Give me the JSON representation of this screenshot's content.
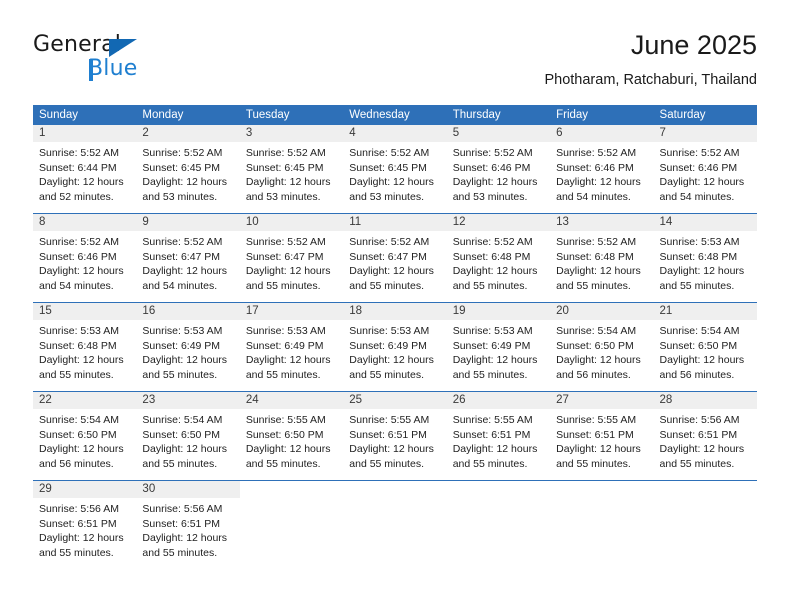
{
  "brand": {
    "name_part1": "General",
    "name_part2": "Blue",
    "flag_icon": "blue-flag-icon"
  },
  "header": {
    "title": "June 2025",
    "location": "Photharam, Ratchaburi, Thailand"
  },
  "colors": {
    "header_blue": "#2e70b8",
    "datebar_gray": "#efefef",
    "brand_blue": "#1f7fd0",
    "text": "#222222"
  },
  "weekdays": [
    "Sunday",
    "Monday",
    "Tuesday",
    "Wednesday",
    "Thursday",
    "Friday",
    "Saturday"
  ],
  "weeks": [
    [
      {
        "date": "1",
        "sunrise": "Sunrise: 5:52 AM",
        "sunset": "Sunset: 6:44 PM",
        "daylight": "Daylight: 12 hours and 52 minutes."
      },
      {
        "date": "2",
        "sunrise": "Sunrise: 5:52 AM",
        "sunset": "Sunset: 6:45 PM",
        "daylight": "Daylight: 12 hours and 53 minutes."
      },
      {
        "date": "3",
        "sunrise": "Sunrise: 5:52 AM",
        "sunset": "Sunset: 6:45 PM",
        "daylight": "Daylight: 12 hours and 53 minutes."
      },
      {
        "date": "4",
        "sunrise": "Sunrise: 5:52 AM",
        "sunset": "Sunset: 6:45 PM",
        "daylight": "Daylight: 12 hours and 53 minutes."
      },
      {
        "date": "5",
        "sunrise": "Sunrise: 5:52 AM",
        "sunset": "Sunset: 6:46 PM",
        "daylight": "Daylight: 12 hours and 53 minutes."
      },
      {
        "date": "6",
        "sunrise": "Sunrise: 5:52 AM",
        "sunset": "Sunset: 6:46 PM",
        "daylight": "Daylight: 12 hours and 54 minutes."
      },
      {
        "date": "7",
        "sunrise": "Sunrise: 5:52 AM",
        "sunset": "Sunset: 6:46 PM",
        "daylight": "Daylight: 12 hours and 54 minutes."
      }
    ],
    [
      {
        "date": "8",
        "sunrise": "Sunrise: 5:52 AM",
        "sunset": "Sunset: 6:46 PM",
        "daylight": "Daylight: 12 hours and 54 minutes."
      },
      {
        "date": "9",
        "sunrise": "Sunrise: 5:52 AM",
        "sunset": "Sunset: 6:47 PM",
        "daylight": "Daylight: 12 hours and 54 minutes."
      },
      {
        "date": "10",
        "sunrise": "Sunrise: 5:52 AM",
        "sunset": "Sunset: 6:47 PM",
        "daylight": "Daylight: 12 hours and 55 minutes."
      },
      {
        "date": "11",
        "sunrise": "Sunrise: 5:52 AM",
        "sunset": "Sunset: 6:47 PM",
        "daylight": "Daylight: 12 hours and 55 minutes."
      },
      {
        "date": "12",
        "sunrise": "Sunrise: 5:52 AM",
        "sunset": "Sunset: 6:48 PM",
        "daylight": "Daylight: 12 hours and 55 minutes."
      },
      {
        "date": "13",
        "sunrise": "Sunrise: 5:52 AM",
        "sunset": "Sunset: 6:48 PM",
        "daylight": "Daylight: 12 hours and 55 minutes."
      },
      {
        "date": "14",
        "sunrise": "Sunrise: 5:53 AM",
        "sunset": "Sunset: 6:48 PM",
        "daylight": "Daylight: 12 hours and 55 minutes."
      }
    ],
    [
      {
        "date": "15",
        "sunrise": "Sunrise: 5:53 AM",
        "sunset": "Sunset: 6:48 PM",
        "daylight": "Daylight: 12 hours and 55 minutes."
      },
      {
        "date": "16",
        "sunrise": "Sunrise: 5:53 AM",
        "sunset": "Sunset: 6:49 PM",
        "daylight": "Daylight: 12 hours and 55 minutes."
      },
      {
        "date": "17",
        "sunrise": "Sunrise: 5:53 AM",
        "sunset": "Sunset: 6:49 PM",
        "daylight": "Daylight: 12 hours and 55 minutes."
      },
      {
        "date": "18",
        "sunrise": "Sunrise: 5:53 AM",
        "sunset": "Sunset: 6:49 PM",
        "daylight": "Daylight: 12 hours and 55 minutes."
      },
      {
        "date": "19",
        "sunrise": "Sunrise: 5:53 AM",
        "sunset": "Sunset: 6:49 PM",
        "daylight": "Daylight: 12 hours and 55 minutes."
      },
      {
        "date": "20",
        "sunrise": "Sunrise: 5:54 AM",
        "sunset": "Sunset: 6:50 PM",
        "daylight": "Daylight: 12 hours and 56 minutes."
      },
      {
        "date": "21",
        "sunrise": "Sunrise: 5:54 AM",
        "sunset": "Sunset: 6:50 PM",
        "daylight": "Daylight: 12 hours and 56 minutes."
      }
    ],
    [
      {
        "date": "22",
        "sunrise": "Sunrise: 5:54 AM",
        "sunset": "Sunset: 6:50 PM",
        "daylight": "Daylight: 12 hours and 56 minutes."
      },
      {
        "date": "23",
        "sunrise": "Sunrise: 5:54 AM",
        "sunset": "Sunset: 6:50 PM",
        "daylight": "Daylight: 12 hours and 55 minutes."
      },
      {
        "date": "24",
        "sunrise": "Sunrise: 5:55 AM",
        "sunset": "Sunset: 6:50 PM",
        "daylight": "Daylight: 12 hours and 55 minutes."
      },
      {
        "date": "25",
        "sunrise": "Sunrise: 5:55 AM",
        "sunset": "Sunset: 6:51 PM",
        "daylight": "Daylight: 12 hours and 55 minutes."
      },
      {
        "date": "26",
        "sunrise": "Sunrise: 5:55 AM",
        "sunset": "Sunset: 6:51 PM",
        "daylight": "Daylight: 12 hours and 55 minutes."
      },
      {
        "date": "27",
        "sunrise": "Sunrise: 5:55 AM",
        "sunset": "Sunset: 6:51 PM",
        "daylight": "Daylight: 12 hours and 55 minutes."
      },
      {
        "date": "28",
        "sunrise": "Sunrise: 5:56 AM",
        "sunset": "Sunset: 6:51 PM",
        "daylight": "Daylight: 12 hours and 55 minutes."
      }
    ],
    [
      {
        "date": "29",
        "sunrise": "Sunrise: 5:56 AM",
        "sunset": "Sunset: 6:51 PM",
        "daylight": "Daylight: 12 hours and 55 minutes."
      },
      {
        "date": "30",
        "sunrise": "Sunrise: 5:56 AM",
        "sunset": "Sunset: 6:51 PM",
        "daylight": "Daylight: 12 hours and 55 minutes."
      },
      {
        "date": "",
        "sunrise": "",
        "sunset": "",
        "daylight": ""
      },
      {
        "date": "",
        "sunrise": "",
        "sunset": "",
        "daylight": ""
      },
      {
        "date": "",
        "sunrise": "",
        "sunset": "",
        "daylight": ""
      },
      {
        "date": "",
        "sunrise": "",
        "sunset": "",
        "daylight": ""
      },
      {
        "date": "",
        "sunrise": "",
        "sunset": "",
        "daylight": ""
      }
    ]
  ]
}
